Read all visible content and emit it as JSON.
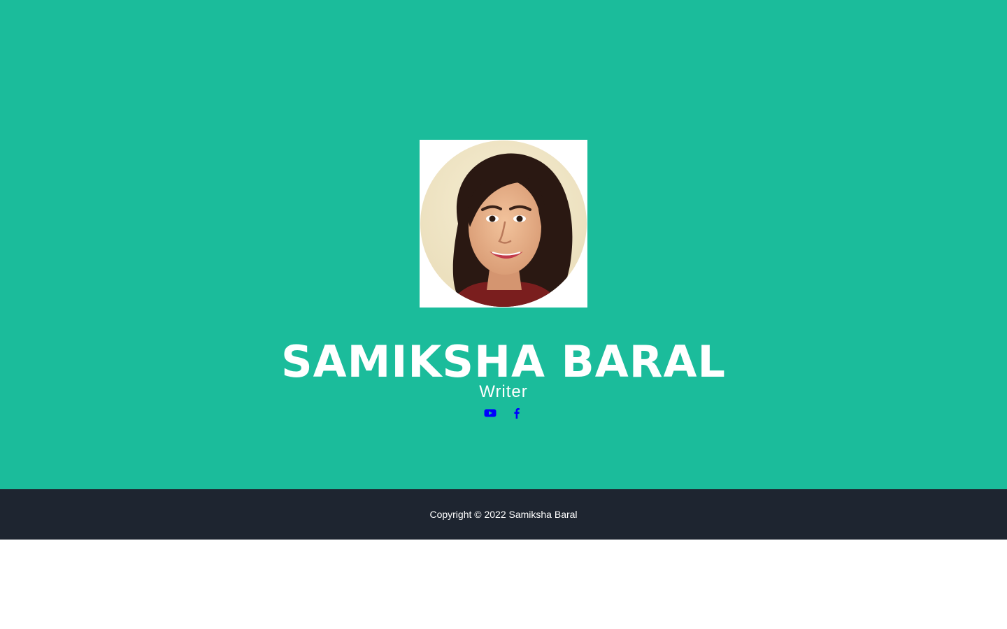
{
  "profile": {
    "name": "SAMIKSHA BARAL",
    "role": "Writer",
    "avatar_icon": "profile-photo"
  },
  "social": [
    {
      "icon": "youtube-icon",
      "color": "#0000ff"
    },
    {
      "icon": "facebook-icon",
      "color": "#0000ff"
    }
  ],
  "footer": {
    "copyright": "Copyright © 2022 Samiksha Baral"
  },
  "colors": {
    "hero_background": "#1bbc9b",
    "footer_background": "#1e2530",
    "text": "#ffffff",
    "link": "#0000ff"
  }
}
